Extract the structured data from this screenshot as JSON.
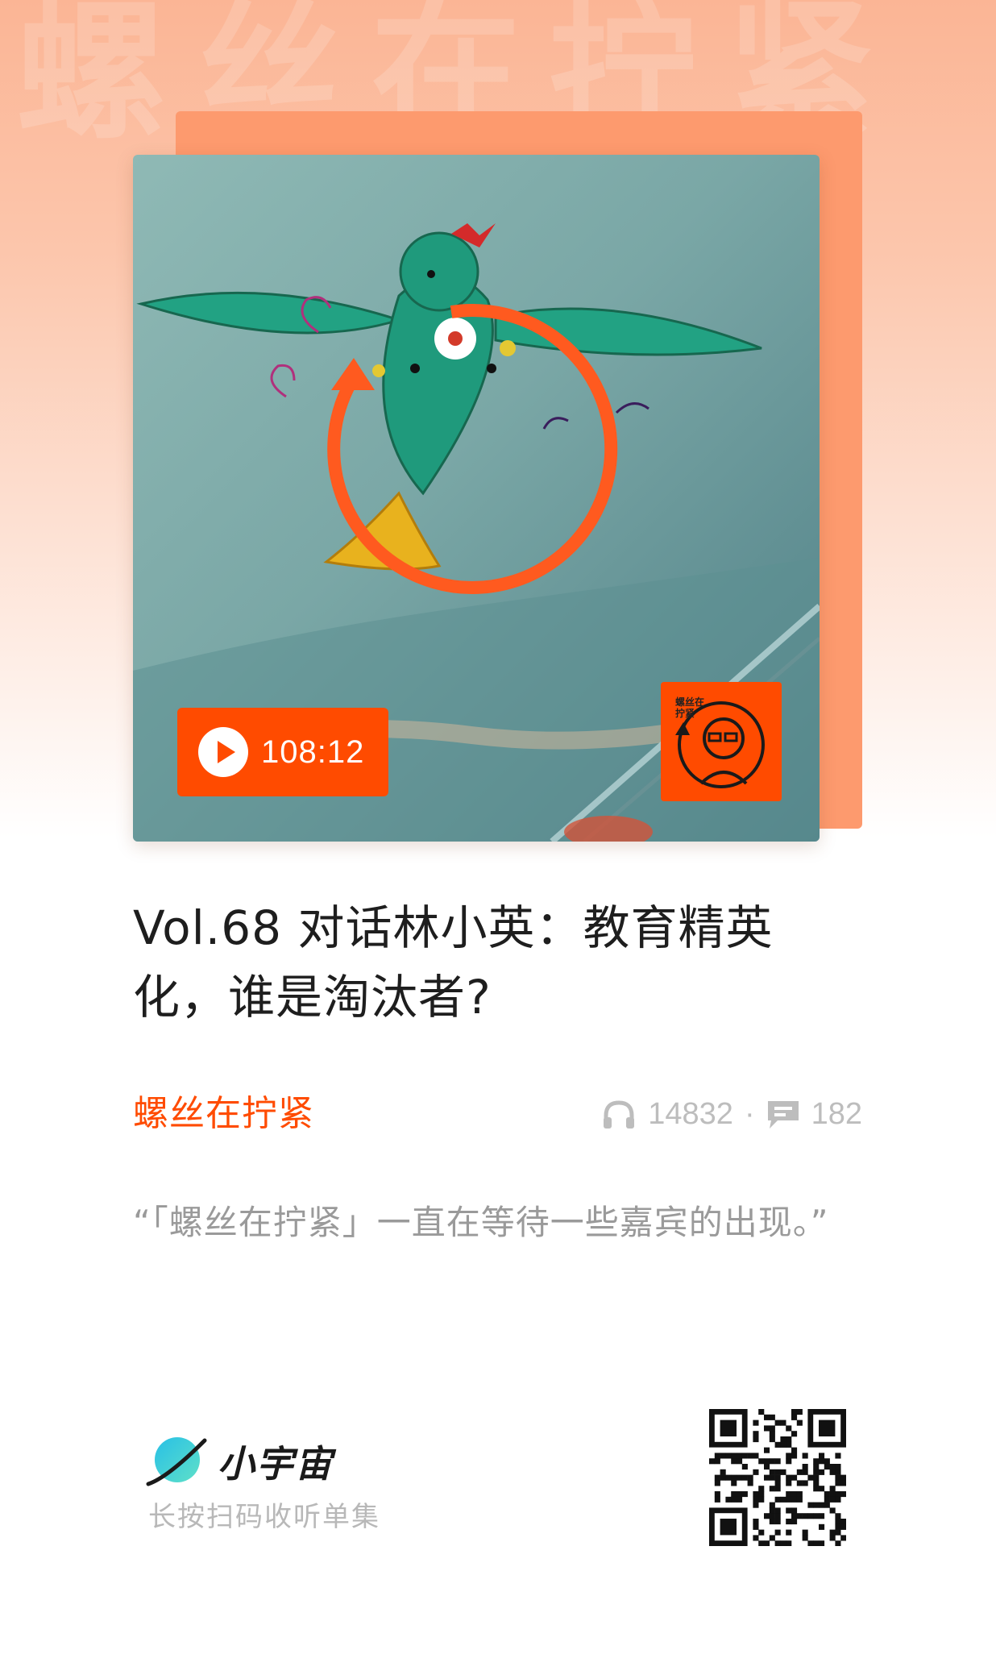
{
  "watermark": "螺丝在拧紧",
  "cover": {
    "duration": "108:12",
    "logo_text": "螺丝在拧紧"
  },
  "episode": {
    "title": "Vol.68 对话林小英：教育精英化，谁是淘汰者?",
    "author": "螺丝在拧紧",
    "plays": "14832",
    "separator": "·",
    "comments": "182",
    "quote": "“「螺丝在拧紧」一直在等待一些嘉宾的出现。”"
  },
  "footer": {
    "brand": "小宇宙",
    "hint": "长按扫码收听单集"
  },
  "colors": {
    "accent": "#ff4b00",
    "card_back": "#fd9a6e",
    "title": "#1e1e1e",
    "muted": "#9a9a9a"
  },
  "icons": {
    "play": "play-icon",
    "plays": "headphones-icon",
    "comments": "comment-icon",
    "brand": "planet-logo-icon"
  }
}
